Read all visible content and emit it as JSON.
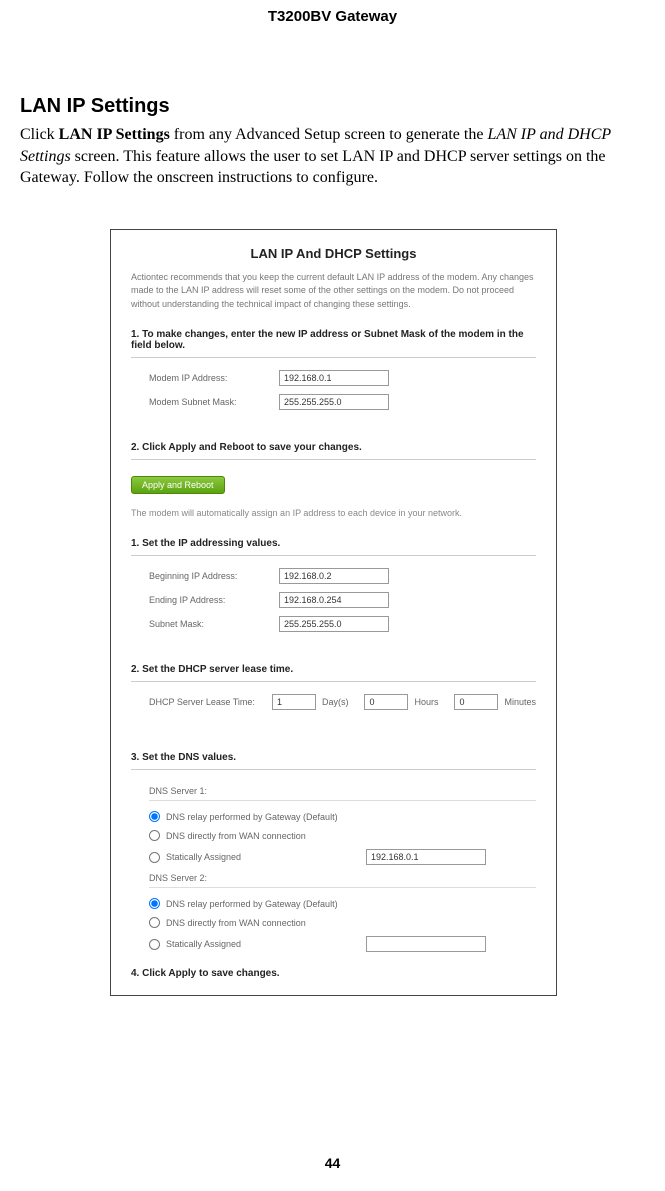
{
  "doc": {
    "header": "T3200BV Gateway",
    "section_title": "LAN IP Settings",
    "body_prefix": "Click ",
    "body_bold": "LAN IP Settings",
    "body_mid": " from any Advanced Setup screen to generate the ",
    "body_italic": "LAN IP and DHCP Settings",
    "body_suffix": " screen. This feature allows the user to set LAN IP and DHCP server settings on the Gateway. Follow the onscreen instructions to configure.",
    "page_number": "44"
  },
  "panel": {
    "title": "LAN IP And DHCP Settings",
    "intro": "Actiontec recommends that you keep the current default LAN IP address of the modem. Any changes made to the LAN IP address will reset some of the other settings on the modem. Do not proceed without understanding the technical impact of changing these settings.",
    "step1": "1. To make changes, enter the new IP address or Subnet Mask of the modem in the field below.",
    "modem_ip_label": "Modem IP Address:",
    "modem_ip_value": "192.168.0.1",
    "modem_mask_label": "Modem Subnet Mask:",
    "modem_mask_value": "255.255.255.0",
    "step2": "2. Click Apply and Reboot to save your changes.",
    "apply_btn": "Apply and Reboot",
    "auto_text": "The modem will automatically assign an IP address to each device in your network.",
    "step1b": "1. Set the IP addressing values.",
    "begin_ip_label": "Beginning IP Address:",
    "begin_ip_value": "192.168.0.2",
    "end_ip_label": "Ending IP Address:",
    "end_ip_value": "192.168.0.254",
    "subnet_label": "Subnet Mask:",
    "subnet_value": "255.255.255.0",
    "step2b": "2. Set the DHCP server lease time.",
    "lease_label": "DHCP Server Lease Time:",
    "lease_days": "1",
    "lease_days_unit": "Day(s)",
    "lease_hours": "0",
    "lease_hours_unit": "Hours",
    "lease_minutes": "0",
    "lease_minutes_unit": "Minutes",
    "step3": "3. Set the DNS values.",
    "dns1_header": "DNS Server 1:",
    "dns_opt_relay": "DNS relay performed by Gateway (Default)",
    "dns_opt_wan": "DNS directly from WAN connection",
    "dns_opt_static": "Statically Assigned",
    "dns1_static_value": "192.168.0.1",
    "dns2_header": "DNS Server 2:",
    "dns2_static_value": "",
    "step4": "4. Click Apply to save changes."
  }
}
